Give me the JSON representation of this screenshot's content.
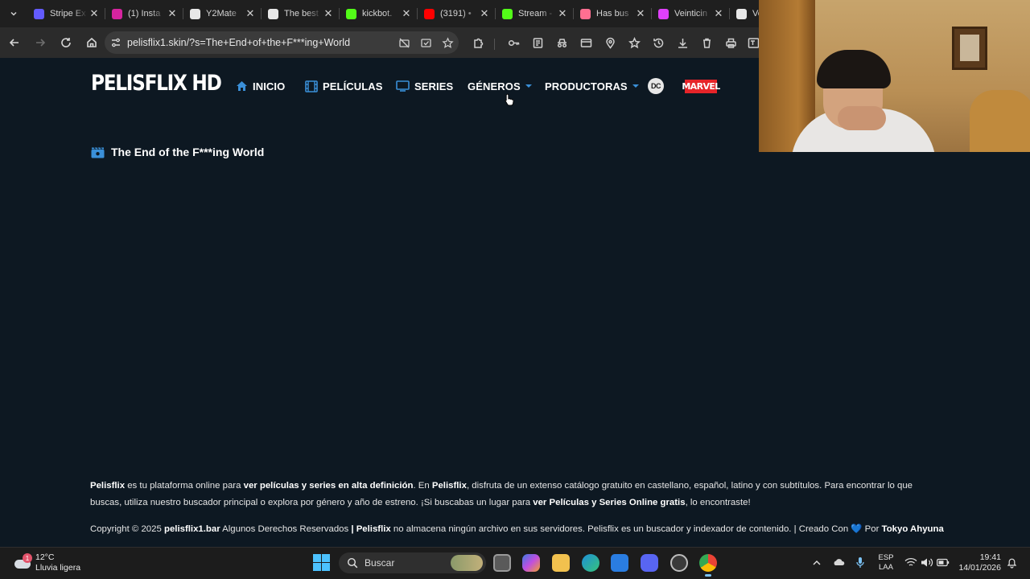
{
  "browser": {
    "tabs": [
      {
        "title": "Stripe Ex",
        "favicon_color": "#635bff"
      },
      {
        "title": "(1) Insta",
        "favicon_color": "#d6249f"
      },
      {
        "title": "Y2Mate",
        "favicon_color": "#e8e8e8"
      },
      {
        "title": "The best",
        "favicon_color": "#e8e8e8"
      },
      {
        "title": "kickbot.",
        "favicon_color": "#53fc18"
      },
      {
        "title": "(3191) •",
        "favicon_color": "#ff0000"
      },
      {
        "title": "Stream -",
        "favicon_color": "#53fc18"
      },
      {
        "title": "Has bus",
        "favicon_color": "#ff6f91"
      },
      {
        "title": "Veinticin",
        "favicon_color": "#e040fb"
      },
      {
        "title": "Ver",
        "favicon_color": "#e8e8e8"
      }
    ],
    "url": "pelisflix1.skin/?s=The+End+of+the+F***ing+World"
  },
  "site": {
    "logo": "PELISFLIX HD",
    "menu": {
      "inicio": "INICIO",
      "peliculas": "PELÍCULAS",
      "series": "SERIES",
      "generos": "GÉNEROS",
      "productoras": "PRODUCTORAS",
      "dc": "DC",
      "marvel": "MARVEL"
    },
    "accent_color": "#3a8fd8",
    "background_color": "#0d1822"
  },
  "search_result": {
    "title": "The End of the F***ing World"
  },
  "footer": {
    "p1_a": "Pelisflix",
    "p1_b": " es tu plataforma online para ",
    "p1_c": "ver películas y series en alta definición",
    "p1_d": ". En ",
    "p1_e": "Pelisflix",
    "p1_f": ", disfruta de un extenso catálogo gratuito en castellano, español, latino y con subtítulos. Para encontrar lo que buscas, utiliza nuestro buscador principal o explora por género y año de estreno. ¡Si buscabas un lugar para ",
    "p1_g": "ver Películas y Series Online gratis",
    "p1_h": ", lo encontraste!",
    "copy_a": "Copyright © 2025 ",
    "copy_b": "pelisflix1.bar",
    "copy_c": " Algunos Derechos Reservados ",
    "copy_d": "| Pelisflix",
    "copy_e": " no almacena ningún archivo en sus servidores. Pelisflix es un buscador y indexador de contenido. | Creado Con ",
    "copy_heart": "💙",
    "copy_f": " Por ",
    "copy_g": "Tokyo Ahyuna"
  },
  "taskbar": {
    "weather_badge": "1",
    "temperature": "12°C",
    "condition": "Lluvia ligera",
    "search_placeholder": "Buscar",
    "lang_top": "ESP",
    "lang_bottom": "LAA",
    "time": "19:41",
    "date": "14/01/2026"
  }
}
